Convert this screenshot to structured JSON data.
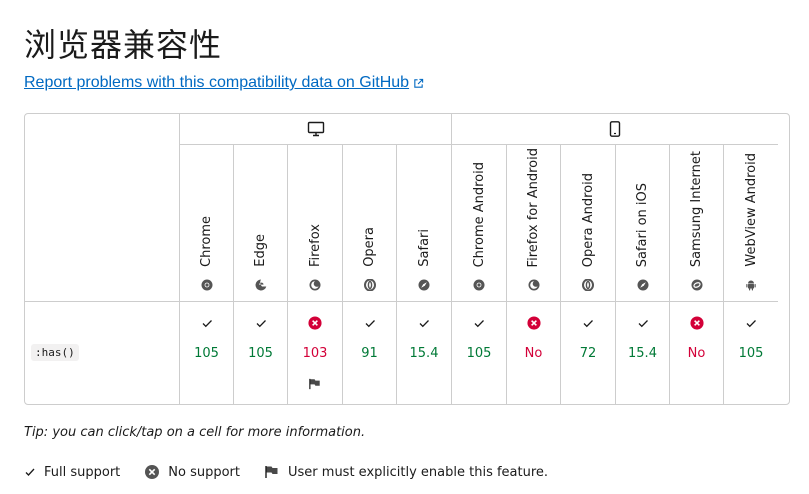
{
  "page": {
    "title": "浏览器兼容性",
    "report_link": "Report problems with this compatibility data on GitHub"
  },
  "platforms": [
    {
      "name": "desktop",
      "icon": "desktop-icon"
    },
    {
      "name": "mobile",
      "icon": "mobile-icon"
    }
  ],
  "browsers": [
    {
      "name": "Chrome",
      "icon": "chrome-icon"
    },
    {
      "name": "Edge",
      "icon": "edge-icon"
    },
    {
      "name": "Firefox",
      "icon": "firefox-icon"
    },
    {
      "name": "Opera",
      "icon": "opera-icon"
    },
    {
      "name": "Safari",
      "icon": "safari-icon"
    },
    {
      "name": "Chrome Android",
      "icon": "chrome-icon"
    },
    {
      "name": "Firefox for Android",
      "icon": "firefox-icon"
    },
    {
      "name": "Opera Android",
      "icon": "opera-icon"
    },
    {
      "name": "Safari on iOS",
      "icon": "safari-icon"
    },
    {
      "name": "Samsung Internet",
      "icon": "samsung-icon"
    },
    {
      "name": "WebView Android",
      "icon": "android-icon"
    }
  ],
  "feature": {
    "name": ":has()",
    "support": [
      {
        "status": "full",
        "value": "105",
        "flag": false
      },
      {
        "status": "full",
        "value": "105",
        "flag": false
      },
      {
        "status": "none",
        "value": "103",
        "flag": true
      },
      {
        "status": "full",
        "value": "91",
        "flag": false
      },
      {
        "status": "full",
        "value": "15.4",
        "flag": false
      },
      {
        "status": "full",
        "value": "105",
        "flag": false
      },
      {
        "status": "none",
        "value": "No",
        "flag": false
      },
      {
        "status": "full",
        "value": "72",
        "flag": false
      },
      {
        "status": "full",
        "value": "15.4",
        "flag": false
      },
      {
        "status": "none",
        "value": "No",
        "flag": false
      },
      {
        "status": "full",
        "value": "105",
        "flag": false
      }
    ]
  },
  "tip": "Tip: you can click/tap on a cell for more information.",
  "legend": {
    "full_support": "Full support",
    "no_support": "No support",
    "flag": "User must explicitly enable this feature."
  },
  "colors": {
    "link": "#0069c2",
    "yes": "#007936",
    "no": "#d30038",
    "border": "#cdcdcd"
  }
}
